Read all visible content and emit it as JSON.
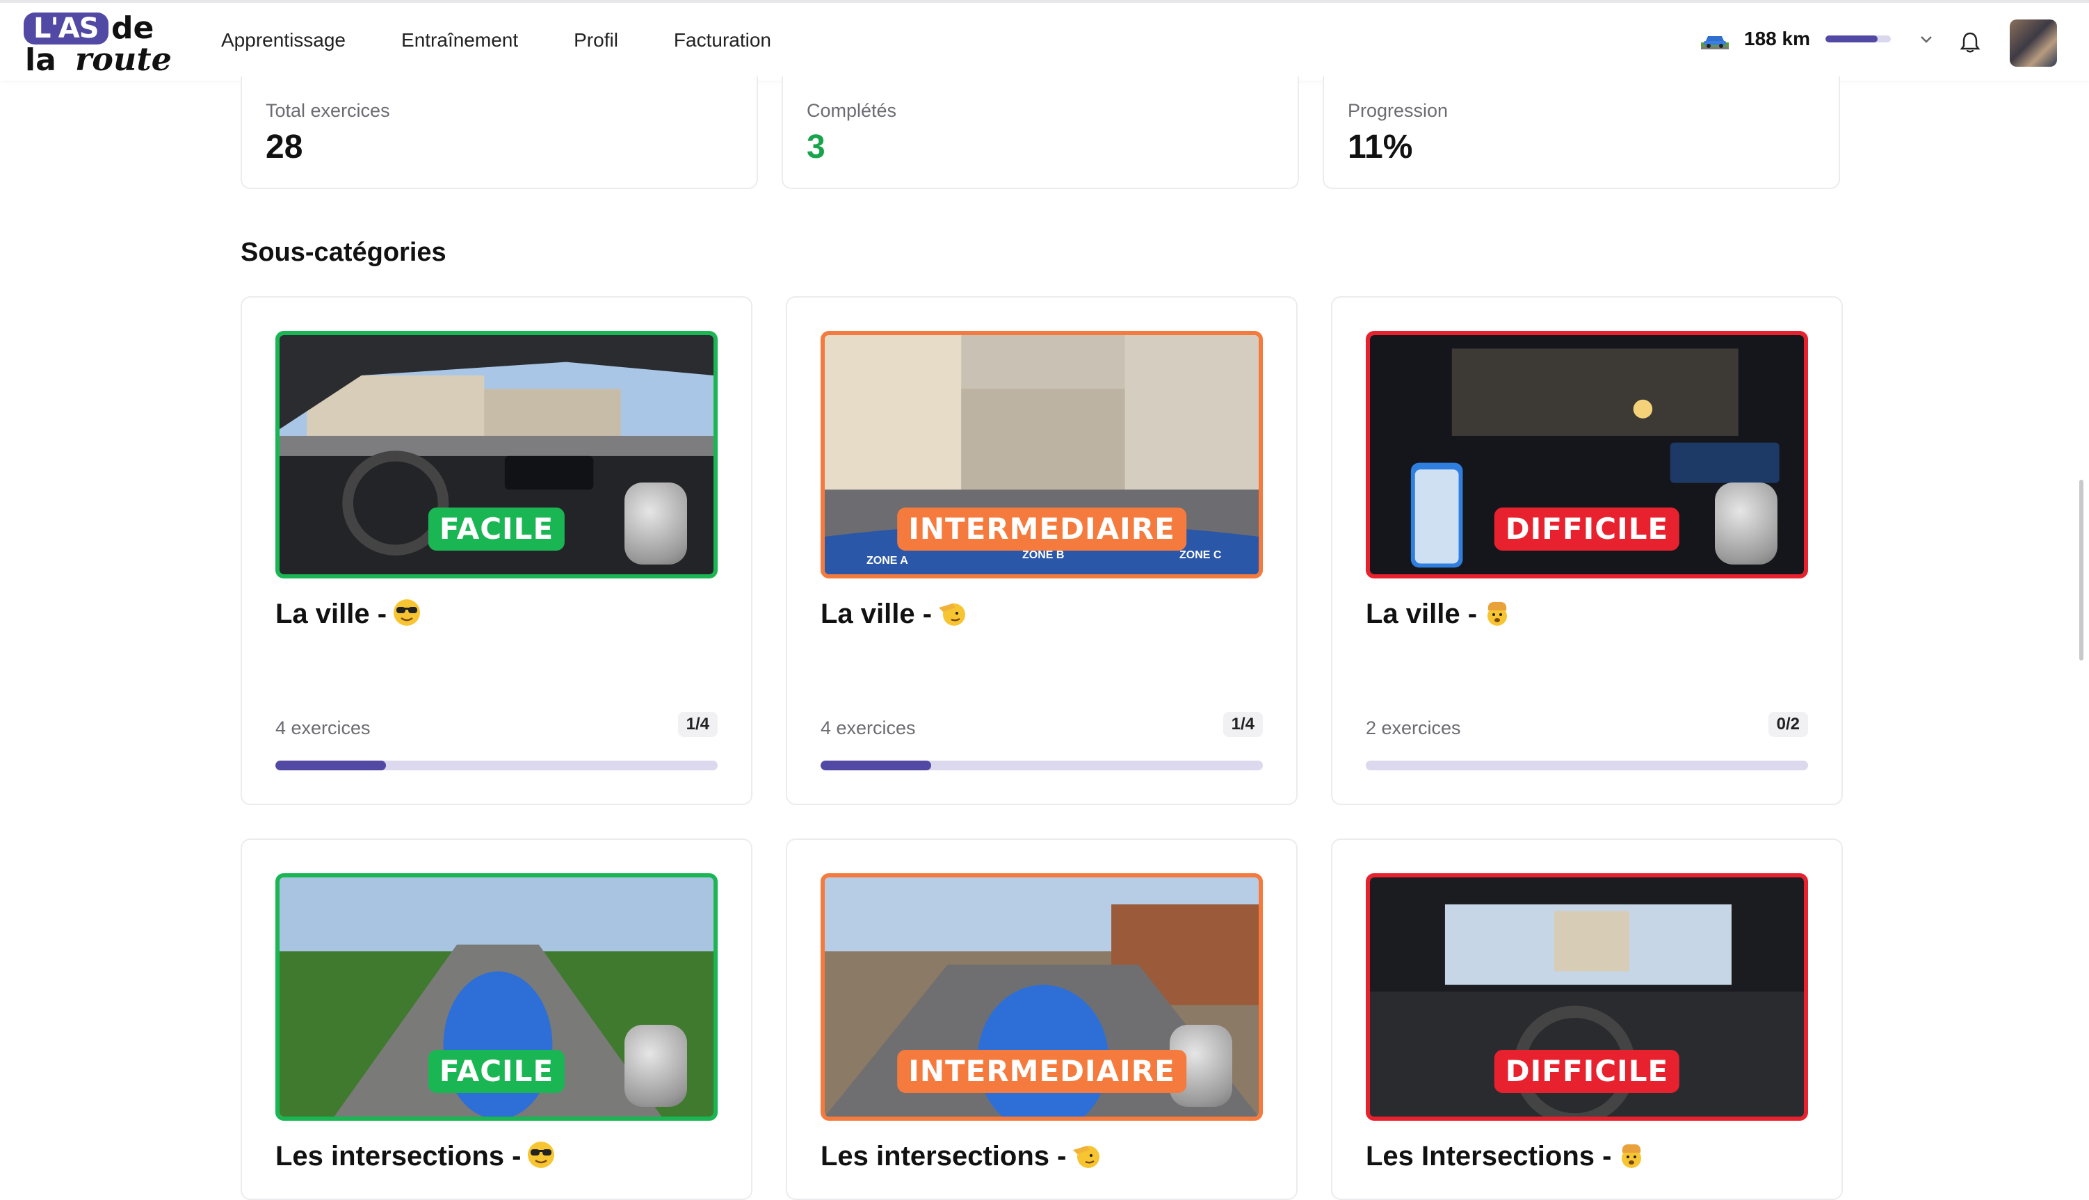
{
  "header": {
    "logo": {
      "as": "L'AS",
      "de": "de",
      "la": "la",
      "route": "route"
    },
    "nav": [
      "Apprentissage",
      "Entraînement",
      "Profil",
      "Facturation"
    ],
    "km": {
      "label": "188 km",
      "progress": 0.8
    },
    "colors": {
      "brand": "#5149a3",
      "green": "#1ab653",
      "orange": "#f47b3d",
      "red": "#e8212e"
    }
  },
  "stats": [
    {
      "label": "Total exercices",
      "value": "28"
    },
    {
      "label": "Complétés",
      "value": "3"
    },
    {
      "label": "Progression",
      "value": "11%"
    }
  ],
  "section_title": "Sous-catégories",
  "cards": [
    {
      "badge": "FACILE",
      "level": "green",
      "title": "La ville -",
      "emoji": "sunglasses-icon",
      "count": "4 exercices",
      "pill": "1/4",
      "progress": 0.25
    },
    {
      "badge": "INTERMEDIAIRE",
      "level": "orange",
      "title": "La ville -",
      "emoji": "salute-icon",
      "count": "4 exercices",
      "pill": "1/4",
      "progress": 0.25,
      "zones": [
        "ZONE A",
        "ZONE B",
        "ZONE C"
      ]
    },
    {
      "badge": "DIFFICILE",
      "level": "red",
      "title": "La ville -",
      "emoji": "exploding-head-icon",
      "count": "2 exercices",
      "pill": "0/2",
      "progress": 0
    },
    {
      "badge": "FACILE",
      "level": "green",
      "title": "Les intersections -",
      "emoji": "sunglasses-icon"
    },
    {
      "badge": "INTERMEDIAIRE",
      "level": "orange",
      "title": "Les intersections -",
      "emoji": "salute-icon"
    },
    {
      "badge": "DIFFICILE",
      "level": "red",
      "title": "Les Intersections -",
      "emoji": "exploding-head-icon"
    }
  ]
}
